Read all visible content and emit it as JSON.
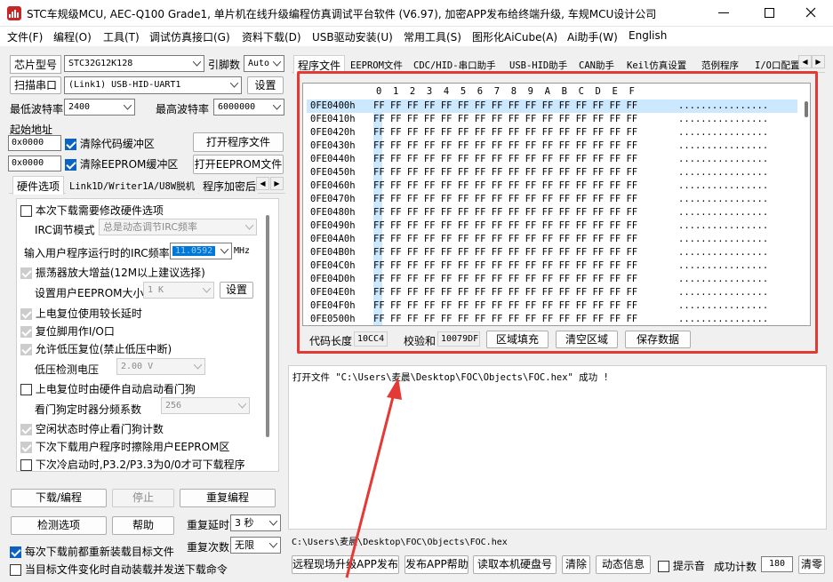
{
  "window": {
    "title": "STC车规级MCU, AEC-Q100 Grade1, 单片机在线升级编程仿真调试平台软件 (V6.97), 加密APP发布给终端升级, 车规MCU设计公司"
  },
  "menu": [
    "文件(F)",
    "编程(O)",
    "工具(T)",
    "调试仿真接口(G)",
    "资料下载(D)",
    "USB驱动安装(U)",
    "常用工具(S)",
    "图形化AiCube(A)",
    "Ai助手(W)",
    "English"
  ],
  "left": {
    "chip_label": "芯片型号",
    "chip_value": "STC32G12K128",
    "pins_label": "引脚数",
    "pins_value": "Auto",
    "scan_button": "扫描串口",
    "port_value": "(Link1) USB-HID-UART1",
    "settings_button": "设置",
    "min_baud_label": "最低波特率",
    "min_baud_value": "2400",
    "max_baud_label": "最高波特率",
    "max_baud_value": "6000000",
    "start_addr_label": "起始地址",
    "code_addr": "0x0000",
    "clear_code_label": "清除代码缓冲区",
    "open_prog_button": "打开程序文件",
    "eeprom_addr": "0x0000",
    "clear_eeprom_label": "清除EEPROM缓冲区",
    "open_eeprom_button": "打开EEPROM文件",
    "tabs": [
      "硬件选项",
      "Link1D/Writer1A/U8W脱机",
      "程序加密后"
    ],
    "options": {
      "modify_hw": "本次下载需要修改硬件选项",
      "irc_mode_label": "IRC调节模式",
      "irc_mode_value": "总是动态调节IRC频率",
      "irc_freq_label": "输入用户程序运行时的IRC频率",
      "irc_freq_value": "11.0592",
      "irc_unit": "MHz",
      "osc_gain": "振荡器放大增益(12M以上建议选择)",
      "eeprom_size_label": "设置用户EEPROM大小",
      "eeprom_size_value": "1  K",
      "eeprom_set_button": "设置",
      "power_delay": "上电复位使用较长延时",
      "reset_io": "复位脚用作I/O口",
      "lvd_reset": "允许低压复位(禁止低压中断)",
      "lvd_label": "低压检测电压",
      "lvd_value": "2.00 V",
      "wdt_hw": "上电复位时由硬件自动启动看门狗",
      "wdt_div_label": "看门狗定时器分频系数",
      "wdt_div_value": "256",
      "idle_wdt": "空闲状态时停止看门狗计数",
      "erase_eeprom": "下次下载用户程序时擦除用户EEPROM区",
      "cold_boot": "下次冷启动时,P3.2/P3.3为0/0才可下载程序"
    },
    "download_button": "下载/编程",
    "stop_button": "停止",
    "reprogram_button": "重复编程",
    "detect_button": "检测选项",
    "help_button": "帮助",
    "repeat_delay_label": "重复延时",
    "repeat_delay_value": "3 秒",
    "repeat_count_label": "重复次数",
    "repeat_count_value": "无限",
    "reload_label": "每次下载前都重新装载目标文件",
    "auto_label": "当目标文件变化时自动装载并发送下载命令"
  },
  "right": {
    "tabs": [
      "程序文件",
      "EEPROM文件",
      "CDC/HID-串口助手",
      "USB-HID助手",
      "CAN助手",
      "Keil仿真设置",
      "范例程序",
      "I/O口配置"
    ],
    "hex_header": "0  1  2  3  4  5  6  7  8  9  A  B  C  D  E  F",
    "rows": [
      {
        "addr": "0FE0400h",
        "hex": "FF FF FF FF FF FF FF FF FF FF FF FF FF FF FF FF",
        "ascii": "................"
      },
      {
        "addr": "0FE0410h",
        "hex": "FF FF FF FF FF FF FF FF FF FF FF FF FF FF FF FF",
        "ascii": "................"
      },
      {
        "addr": "0FE0420h",
        "hex": "FF FF FF FF FF FF FF FF FF FF FF FF FF FF FF FF",
        "ascii": "................"
      },
      {
        "addr": "0FE0430h",
        "hex": "FF FF FF FF FF FF FF FF FF FF FF FF FF FF FF FF",
        "ascii": "................"
      },
      {
        "addr": "0FE0440h",
        "hex": "FF FF FF FF FF FF FF FF FF FF FF FF FF FF FF FF",
        "ascii": "................"
      },
      {
        "addr": "0FE0450h",
        "hex": "FF FF FF FF FF FF FF FF FF FF FF FF FF FF FF FF",
        "ascii": "................"
      },
      {
        "addr": "0FE0460h",
        "hex": "FF FF FF FF FF FF FF FF FF FF FF FF FF FF FF FF",
        "ascii": "................"
      },
      {
        "addr": "0FE0470h",
        "hex": "FF FF FF FF FF FF FF FF FF FF FF FF FF FF FF FF",
        "ascii": "................"
      },
      {
        "addr": "0FE0480h",
        "hex": "FF FF FF FF FF FF FF FF FF FF FF FF FF FF FF FF",
        "ascii": "................"
      },
      {
        "addr": "0FE0490h",
        "hex": "FF FF FF FF FF FF FF FF FF FF FF FF FF FF FF FF",
        "ascii": "................"
      },
      {
        "addr": "0FE04A0h",
        "hex": "FF FF FF FF FF FF FF FF FF FF FF FF FF FF FF FF",
        "ascii": "................"
      },
      {
        "addr": "0FE04B0h",
        "hex": "FF FF FF FF FF FF FF FF FF FF FF FF FF FF FF FF",
        "ascii": "................"
      },
      {
        "addr": "0FE04C0h",
        "hex": "FF FF FF FF FF FF FF FF FF FF FF FF FF FF FF FF",
        "ascii": "................"
      },
      {
        "addr": "0FE04D0h",
        "hex": "FF FF FF FF FF FF FF FF FF FF FF FF FF FF FF FF",
        "ascii": "................"
      },
      {
        "addr": "0FE04E0h",
        "hex": "FF FF FF FF FF FF FF FF FF FF FF FF FF FF FF FF",
        "ascii": "................"
      },
      {
        "addr": "0FE04F0h",
        "hex": "FF FF FF FF FF FF FF FF FF FF FF FF FF FF FF FF",
        "ascii": "................"
      },
      {
        "addr": "0FE0500h",
        "hex": "FF FF FF FF FF FF FF FF FF FF FF FF FF FF FF FF",
        "ascii": "................"
      }
    ],
    "code_len_label": "代码长度",
    "code_len_value": "10CC4",
    "checksum_label": "校验和",
    "checksum_value": "10079DF",
    "fill_button": "区域填充",
    "clear_button": "清空区域",
    "save_button": "保存数据",
    "log_text": "打开文件 \"C:\\Users\\麦晨\\Desktop\\FOC\\Objects\\FOC.hex\" 成功 !",
    "path_text": "C:\\Users\\麦晨\\Desktop\\FOC\\Objects\\FOC.hex",
    "bottom_buttons": [
      "远程现场升级APP发布",
      "发布APP帮助",
      "读取本机硬盘号",
      "清除",
      "动态信息"
    ],
    "beep_label": "提示音",
    "success_label": "成功计数",
    "success_value": "180",
    "reset_button": "清零"
  },
  "colors": {
    "highlight": "#e53935",
    "accent": "#0b62c4",
    "selection": "#cce8ff"
  }
}
